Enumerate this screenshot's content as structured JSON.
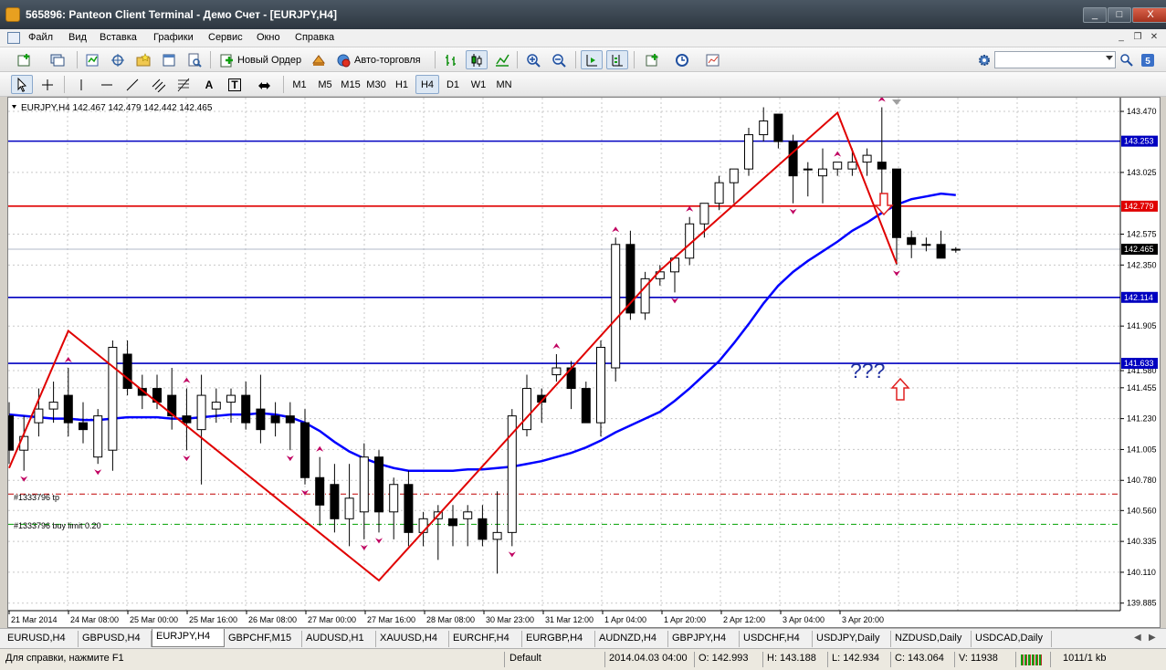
{
  "window": {
    "title": "565896: Panteon Client Terminal - Демо Счет - [EURJPY,H4]",
    "minimize": "_",
    "maximize": "□",
    "close": "X"
  },
  "menu": [
    "Файл",
    "Вид",
    "Вставка",
    "Графики",
    "Сервис",
    "Окно",
    "Справка"
  ],
  "toolbar1": {
    "new_order": "Новый Ордер",
    "auto_trading": "Авто-торговля"
  },
  "toolbar2": {
    "arrow_labels": [
      "A",
      "T"
    ],
    "timeframes": [
      "M1",
      "M5",
      "M15",
      "M30",
      "H1",
      "H4",
      "D1",
      "W1",
      "MN"
    ],
    "active_timeframe": "H4"
  },
  "chart": {
    "header": "EURJPY,H4  142.467 142.479 142.442 142.465",
    "label_tp": "#1333796 tp",
    "label_buy_limit": "#1333796 buy limit 0.20",
    "annotation": "???",
    "price_ticks": [
      "143.470",
      "143.025",
      "142.575",
      "142.350",
      "141.905",
      "141.580",
      "141.455",
      "141.230",
      "141.005",
      "140.780",
      "140.560",
      "140.335",
      "140.110",
      "139.885"
    ],
    "level_labels": [
      "143.253",
      "142.779",
      "142.465",
      "142.114",
      "141.633"
    ],
    "time_ticks": [
      "21 Mar 2014",
      "24 Mar 08:00",
      "25 Mar 00:00",
      "25 Mar 16:00",
      "26 Mar 08:00",
      "27 Mar 00:00",
      "27 Mar 16:00",
      "28 Mar 08:00",
      "30 Mar 23:00",
      "31 Mar 12:00",
      "1 Apr 04:00",
      "1 Apr 20:00",
      "2 Apr 12:00",
      "3 Apr 04:00",
      "3 Apr 20:00"
    ]
  },
  "chart_data": {
    "type": "candlestick",
    "symbol": "EURJPY",
    "timeframe": "H4",
    "ylim": [
      139.83,
      143.57
    ],
    "candles": [
      [
        141.25,
        141.35,
        140.9,
        141.0
      ],
      [
        141.0,
        141.25,
        140.85,
        141.1
      ],
      [
        141.2,
        141.45,
        141.1,
        141.3
      ],
      [
        141.3,
        141.5,
        141.2,
        141.35
      ],
      [
        141.4,
        141.6,
        141.1,
        141.2
      ],
      [
        141.2,
        141.35,
        141.05,
        141.15
      ],
      [
        140.95,
        141.3,
        140.9,
        141.25
      ],
      [
        141.0,
        141.8,
        140.85,
        141.75
      ],
      [
        141.7,
        141.8,
        141.4,
        141.45
      ],
      [
        141.45,
        141.55,
        141.3,
        141.4
      ],
      [
        141.45,
        141.55,
        141.3,
        141.35
      ],
      [
        141.4,
        141.6,
        141.15,
        141.25
      ],
      [
        141.25,
        141.45,
        141.0,
        141.2
      ],
      [
        141.15,
        141.55,
        140.75,
        141.4
      ],
      [
        141.3,
        141.45,
        141.2,
        141.35
      ],
      [
        141.35,
        141.45,
        141.2,
        141.4
      ],
      [
        141.4,
        141.5,
        141.15,
        141.2
      ],
      [
        141.3,
        141.55,
        141.05,
        141.15
      ],
      [
        141.25,
        141.35,
        141.1,
        141.2
      ],
      [
        141.25,
        141.35,
        141.0,
        141.2
      ],
      [
        141.2,
        141.3,
        140.75,
        140.8
      ],
      [
        140.8,
        140.95,
        140.45,
        140.6
      ],
      [
        140.75,
        140.9,
        140.4,
        140.5
      ],
      [
        140.5,
        140.9,
        140.3,
        140.65
      ],
      [
        140.55,
        141.05,
        140.35,
        140.95
      ],
      [
        140.95,
        141.0,
        140.4,
        140.55
      ],
      [
        140.55,
        140.8,
        140.35,
        140.75
      ],
      [
        140.75,
        140.85,
        140.3,
        140.4
      ],
      [
        140.4,
        140.55,
        140.3,
        140.5
      ],
      [
        140.5,
        140.6,
        140.2,
        140.55
      ],
      [
        140.5,
        140.6,
        140.3,
        140.45
      ],
      [
        140.5,
        140.6,
        140.3,
        140.55
      ],
      [
        140.5,
        140.6,
        140.3,
        140.35
      ],
      [
        140.35,
        140.7,
        140.1,
        140.4
      ],
      [
        140.4,
        141.3,
        140.3,
        141.25
      ],
      [
        141.15,
        141.55,
        141.1,
        141.45
      ],
      [
        141.4,
        141.45,
        141.2,
        141.35
      ],
      [
        141.55,
        141.7,
        141.5,
        141.6
      ],
      [
        141.6,
        141.65,
        141.3,
        141.45
      ],
      [
        141.45,
        141.5,
        141.2,
        141.2
      ],
      [
        141.2,
        141.8,
        141.1,
        141.75
      ],
      [
        141.6,
        142.55,
        141.5,
        142.5
      ],
      [
        142.5,
        142.6,
        141.95,
        142.0
      ],
      [
        142.0,
        142.3,
        141.95,
        142.25
      ],
      [
        142.25,
        142.35,
        142.2,
        142.3
      ],
      [
        142.3,
        142.4,
        142.15,
        142.4
      ],
      [
        142.4,
        142.7,
        142.35,
        142.65
      ],
      [
        142.65,
        142.8,
        142.55,
        142.8
      ],
      [
        142.8,
        143.0,
        142.75,
        142.95
      ],
      [
        142.95,
        143.05,
        142.8,
        143.05
      ],
      [
        143.05,
        143.35,
        143.0,
        143.3
      ],
      [
        143.3,
        143.5,
        143.25,
        143.4
      ],
      [
        143.45,
        143.45,
        143.2,
        143.25
      ],
      [
        143.25,
        143.3,
        142.8,
        143.0
      ],
      [
        143.05,
        143.1,
        142.85,
        143.05
      ],
      [
        143.0,
        143.2,
        142.8,
        143.05
      ],
      [
        143.05,
        143.1,
        143.0,
        143.1
      ],
      [
        143.05,
        143.2,
        143.0,
        143.1
      ],
      [
        143.1,
        143.2,
        143.0,
        143.15
      ],
      [
        143.1,
        143.5,
        142.8,
        143.05
      ],
      [
        143.05,
        143.05,
        142.35,
        142.55
      ],
      [
        142.55,
        142.6,
        142.4,
        142.5
      ],
      [
        142.5,
        142.55,
        142.45,
        142.5
      ],
      [
        142.5,
        142.6,
        142.45,
        142.4
      ],
      [
        142.46,
        142.48,
        142.44,
        142.465
      ]
    ],
    "moving_average": [
      141.26,
      141.25,
      141.24,
      141.23,
      141.23,
      141.22,
      141.22,
      141.23,
      141.24,
      141.24,
      141.24,
      141.23,
      141.23,
      141.24,
      141.25,
      141.26,
      141.26,
      141.27,
      141.26,
      141.24,
      141.2,
      141.14,
      141.06,
      140.99,
      140.94,
      140.9,
      140.87,
      140.85,
      140.85,
      140.85,
      140.85,
      140.86,
      140.86,
      140.87,
      140.88,
      140.9,
      140.92,
      140.95,
      140.98,
      141.02,
      141.07,
      141.13,
      141.18,
      141.23,
      141.28,
      141.36,
      141.45,
      141.55,
      141.65,
      141.78,
      141.92,
      142.07,
      142.2,
      142.3,
      142.38,
      142.45,
      142.52,
      142.6,
      142.66,
      142.73,
      142.79,
      142.83,
      142.85,
      142.87,
      142.86
    ],
    "zigzag": [
      [
        0,
        140.87
      ],
      [
        4,
        141.87
      ],
      [
        25,
        140.05
      ],
      [
        44,
        142.31
      ],
      [
        56,
        143.46
      ],
      [
        60,
        142.36
      ]
    ],
    "horizontal_levels": [
      {
        "price": 143.253,
        "color": "#0000c0",
        "style": "solid"
      },
      {
        "price": 142.779,
        "color": "#e00000",
        "style": "solid"
      },
      {
        "price": 142.465,
        "color": "#b0b8c8",
        "style": "solid"
      },
      {
        "price": 142.114,
        "color": "#0000c0",
        "style": "solid"
      },
      {
        "price": 141.633,
        "color": "#0000c0",
        "style": "solid"
      },
      {
        "price": 140.68,
        "color": "#c00000",
        "style": "dash-dot"
      },
      {
        "price": 140.46,
        "color": "#00a000",
        "style": "dash-dot"
      }
    ],
    "colors": {
      "bull_body": "#ffffff",
      "bear_body": "#000000",
      "ma": "#0000ff",
      "zigzag": "#e00000",
      "fractal": "#c00060",
      "grid": "#c8c8c8"
    }
  },
  "symbol_tabs": [
    "EURUSD,H4",
    "GBPUSD,H4",
    "EURJPY,H4",
    "GBPCHF,M15",
    "AUDUSD,H1",
    "XAUUSD,H4",
    "EURCHF,H4",
    "EURGBP,H4",
    "AUDNZD,H4",
    "GBPJPY,H4",
    "USDCHF,H4",
    "USDJPY,Daily",
    "NZDUSD,Daily",
    "USDCAD,Daily"
  ],
  "active_tab": "EURJPY,H4",
  "status": {
    "help": "Для справки, нажмите F1",
    "profile": "Default",
    "datetime": "2014.04.03 04:00",
    "open": "O: 142.993",
    "high": "H: 143.188",
    "low": "L: 142.934",
    "close": "C: 143.064",
    "volume": "V: 11938",
    "traffic": "1011/1 kb"
  }
}
